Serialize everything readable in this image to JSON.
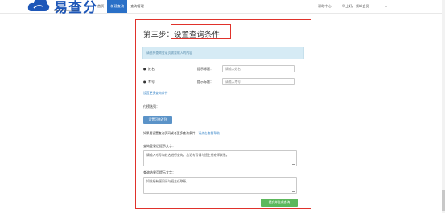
{
  "header": {
    "brand_name": "易查分",
    "brand_url": "www.Yichafen.com",
    "nav": [
      {
        "label": "首页",
        "active": false
      },
      {
        "label": "新建查询",
        "active": true
      },
      {
        "label": "查询管理",
        "active": false
      }
    ],
    "help_label": "帮助中心",
    "greeting": "早上好，领峰会员",
    "caret": "▾",
    "accent_color": "#2a70c7"
  },
  "panel": {
    "step_prefix": "第三步：",
    "step_title": "设置查询条件",
    "info_text": "请选择查询登录页需要输入的内容",
    "fields": [
      {
        "name": "姓名",
        "tip_label": "提示标题：",
        "placeholder": "请输入姓名"
      },
      {
        "name": "考号",
        "tip_label": "提示标题：",
        "placeholder": "请输入考号"
      }
    ],
    "more_link": "设置更多查询条件",
    "sort_label": "付榜选列：",
    "sort_button": "设置可修改列",
    "hint_text": "如果要设置查询页码或者更多查询条件，",
    "hint_link": "请点击查看帮助",
    "login_tip_label": "查询登录后提示文字：",
    "login_tip_text": "请输入考号和姓名进行查询，忘记考号请与班主任老师联系。",
    "result_tip_label": "查询结果页提示文字：",
    "result_tip_text": "如成绩有疑问请与班主任联系。",
    "submit_button": "提交并生成查询",
    "highlight_color": "#e0322b"
  }
}
